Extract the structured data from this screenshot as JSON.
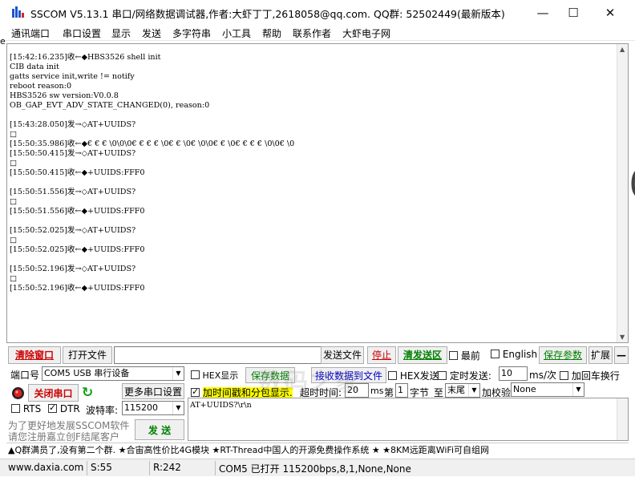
{
  "window": {
    "title": "SSCOM V5.13.1 串口/网络数据调试器,作者:大虾丁丁,2618058@qq.com. QQ群: 52502449(最新版本)"
  },
  "menu": [
    "通讯端口",
    "串口设置",
    "显示",
    "发送",
    "多字符串",
    "小工具",
    "帮助",
    "联系作者",
    "大虾电子网"
  ],
  "left_edge_char": "e",
  "receive": {
    "lines": [
      "[15:42:16.235]收←◆HBS3526 shell init",
      "CIB data init",
      "gatts service init,write != notify",
      "reboot reason:0",
      "HBS3526 sw version:V0.0.8",
      "OB_GAP_EVT_ADV_STATE_CHANGED(0), reason:0",
      "",
      "[15:43:28.050]发→◇AT+UUIDS?",
      "□",
      "[15:50:35.986]收←◆€ € € \\0\\0\\0€ € € € \\0€ € \\0€ \\0\\0€ € \\0€ € € € \\0\\0€ \\0",
      "[15:50:50.415]发→◇AT+UUIDS?",
      "□",
      "[15:50:50.415]收←◆+UUIDS:FFF0",
      "",
      "[15:50:51.556]发→◇AT+UUIDS?",
      "□",
      "[15:50:51.556]收←◆+UUIDS:FFF0",
      "",
      "[15:50:52.025]发→◇AT+UUIDS?",
      "□",
      "[15:50:52.025]收←◆+UUIDS:FFF0",
      "",
      "[15:50:52.196]发→◇AT+UUIDS?",
      "□",
      "[15:50:52.196]收←◆+UUIDS:FFF0"
    ],
    "right_edge_glyph": "("
  },
  "toolbar": {
    "clear_window": "清除窗口",
    "open_file": "打开文件",
    "send_file": "发送文件",
    "stop": "停止",
    "clear_send": "清发送区",
    "last": "最前",
    "english": "English",
    "save_params": "保存参数",
    "expand": "扩展",
    "collapse": "—"
  },
  "port": {
    "port_label": "端口号",
    "port_value": "COM5 USB 串行设备",
    "close_port": "关闭串口",
    "more_settings": "更多串口设置",
    "rts": "RTS",
    "dtr": "DTR",
    "dtr_checked": true,
    "rts_checked": false,
    "baud_label": "波特率:",
    "baud_value": "115200",
    "promo_line1": "为了更好地发展SSCOM软件",
    "promo_line2": "请您注册嘉立创F结尾客户",
    "send_button": "发  送"
  },
  "options": {
    "hex_display": "HEX显示",
    "save_data": "保存数据",
    "recv_to_file": "接收数据到文件",
    "hex_send": "HEX发送",
    "timed_send": "定时发送:",
    "timed_value": "10",
    "timed_unit": "ms/次",
    "add_crlf": "加回车换行",
    "timestamp": "加时间戳和分包显示.",
    "timestamp_checked": true,
    "timeout_label": "超时时间:",
    "timeout_value": "20",
    "timeout_unit": "ms",
    "nth_label": "第",
    "nth_value": "1",
    "byte_label": "字节",
    "to_label": "至",
    "to_value": "末尾",
    "checksum_label": "加校验",
    "checksum_value": "None"
  },
  "send_text": "AT+UUIDS?\\r\\n",
  "watermark": "数码之家",
  "ticker": "▲Q群满员了,没有第二个群. ★合宙高性价比4G模块 ★RT-Thread中国人的开源免费操作系统 ★ ★8KM远距离WiFi可自组网",
  "status": {
    "website": "www.daxia.com",
    "sent": "S:55",
    "received": "R:242",
    "port_state": "COM5 已打开  115200bps,8,1,None,None"
  },
  "colors": {
    "red_button_text": "#cc0000",
    "green_button_text": "#008000",
    "blue_link": "#0000ff",
    "highlight_yellow": "#ffff00",
    "status_bg": "#f0f0f0"
  }
}
